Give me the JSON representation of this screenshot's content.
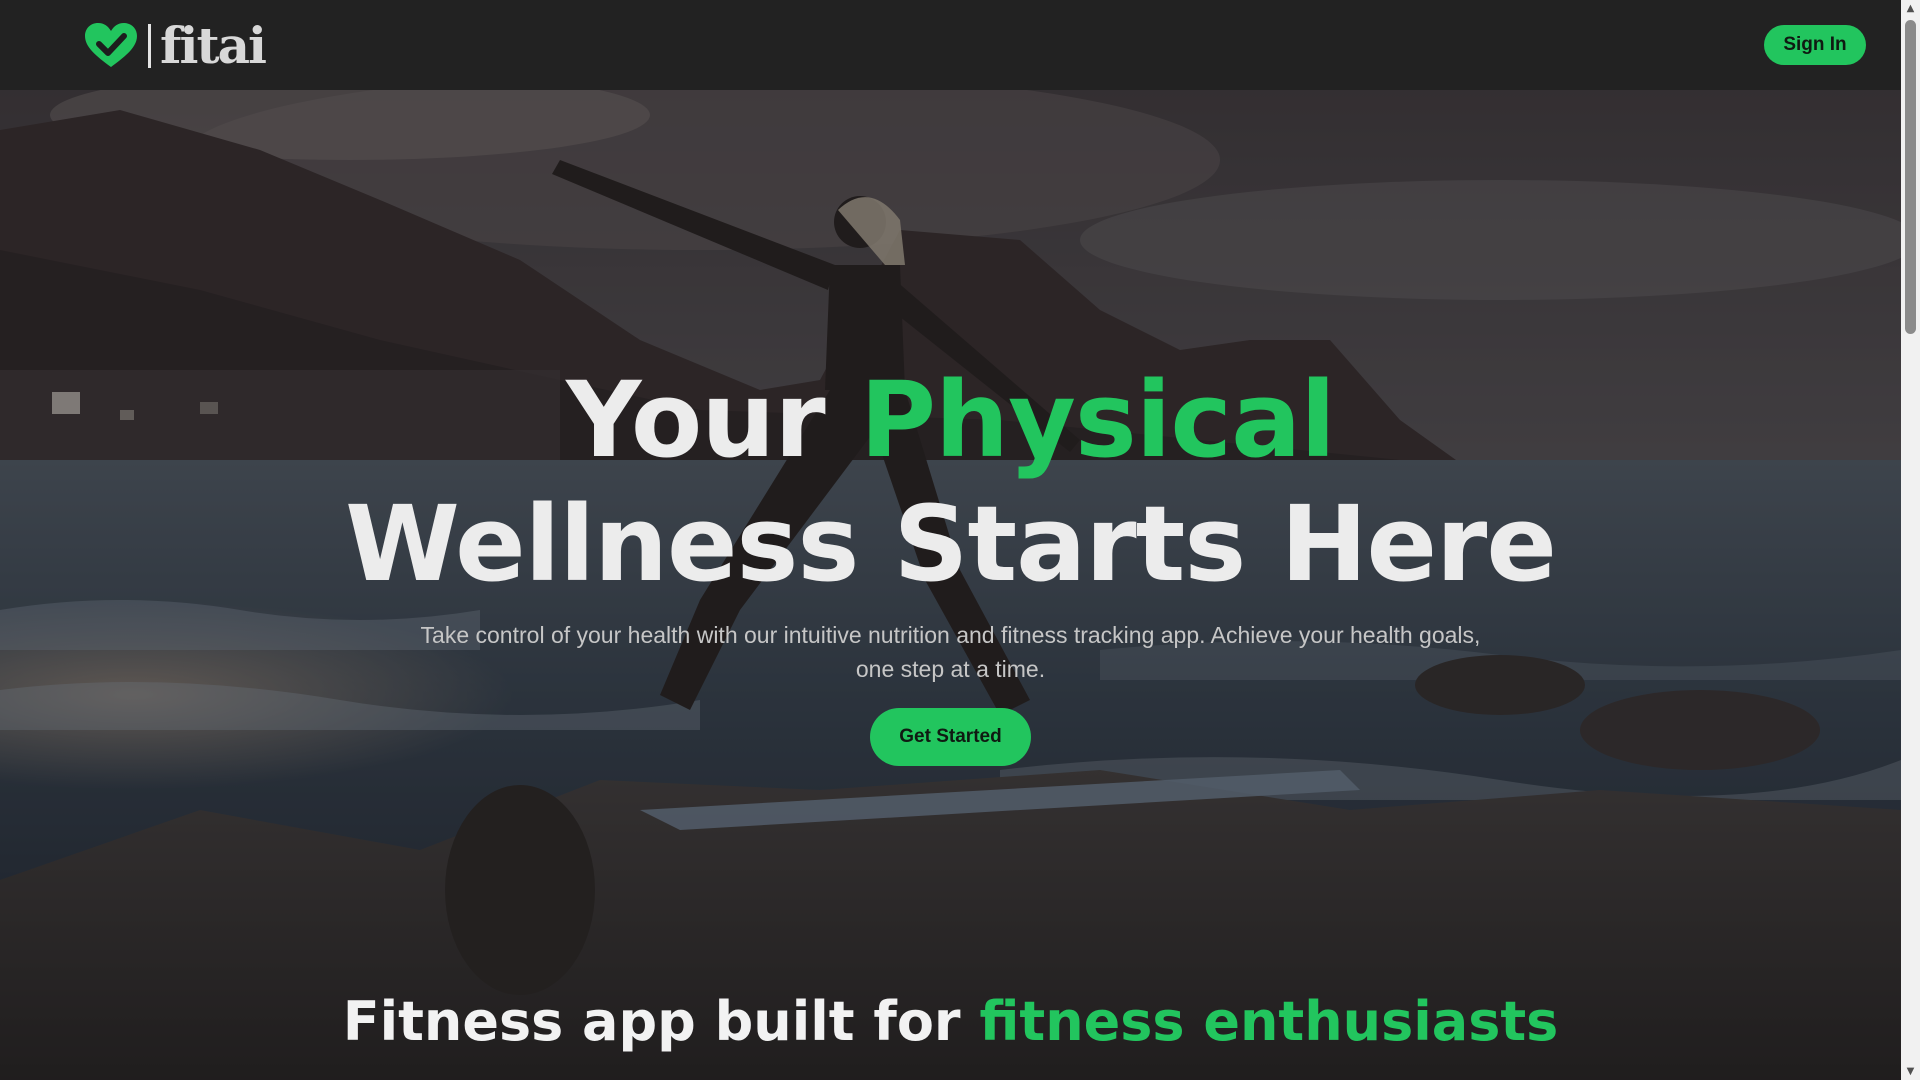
{
  "brand": {
    "name": "fitai",
    "accent_color": "#22c55e",
    "icon": "heart-check-icon"
  },
  "header": {
    "signin_label": "Sign In"
  },
  "hero": {
    "headline_part1": "Your ",
    "headline_accent": "Physical",
    "headline_part2": "Wellness Starts Here",
    "subtitle": "Take control of your health with our intuitive nutrition and fitness tracking app. Achieve your health goals, one step at a time.",
    "cta_label": "Get Started",
    "background_image": "yoga-by-the-sea-photo"
  },
  "section": {
    "title_part1": "Fitness app built for ",
    "title_accent": "fitness enthusiasts"
  },
  "scrollbar": {
    "up_icon": "triangle-up-icon",
    "down_icon": "triangle-down-icon"
  }
}
